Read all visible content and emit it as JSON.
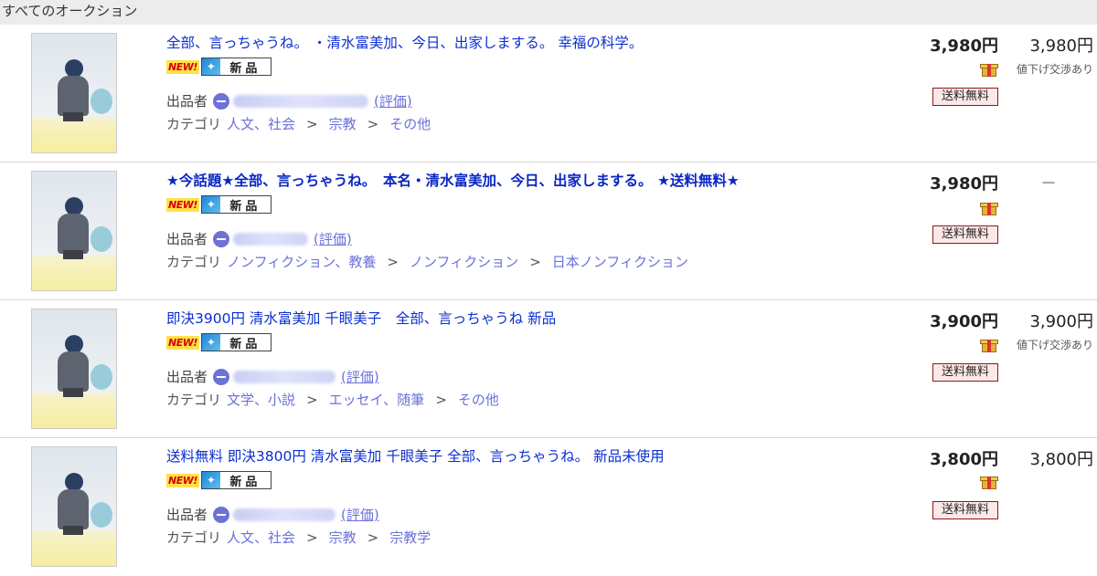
{
  "section_title": "すべてのオークション",
  "common": {
    "badge_new": "NEW!",
    "condition_label": "新品",
    "seller_label": "出品者",
    "rating_label": "(評価)",
    "category_label": "カテゴリ",
    "shipping_badge": "送料無料",
    "gift_icon": "gift-box-icon",
    "minus_icon": "minus-circle-icon"
  },
  "listings": [
    {
      "title": "全部、言っちゃうね。 ・清水富美加、今日、出家しまする。 幸福の科学。",
      "title_bold": false,
      "price_current": "3,980円",
      "price_buyout": "3,980円",
      "negotiable": "値下げ交渉あり",
      "categories": [
        "人文、社会",
        "宗教",
        "その他"
      ]
    },
    {
      "title": "★今話題★全部、言っちゃうね。　本名・清水富美加、今日、出家しまする。 ★送料無料★",
      "title_bold": true,
      "price_current": "3,980円",
      "price_buyout": "－",
      "negotiable": "",
      "categories": [
        "ノンフィクション、教養",
        "ノンフィクション",
        "日本ノンフィクション"
      ]
    },
    {
      "title": "即決3900円 清水富美加 千眼美子　全部、言っちゃうね 新品",
      "title_bold": false,
      "price_current": "3,900円",
      "price_buyout": "3,900円",
      "negotiable": "値下げ交渉あり",
      "categories": [
        "文学、小説",
        "エッセイ、随筆",
        "その他"
      ]
    },
    {
      "title": "送料無料 即決3800円 清水富美加 千眼美子 全部、言っちゃうね。 新品未使用",
      "title_bold": false,
      "price_current": "3,800円",
      "price_buyout": "3,800円",
      "negotiable": "",
      "categories": [
        "人文、社会",
        "宗教",
        "宗教学"
      ]
    }
  ]
}
